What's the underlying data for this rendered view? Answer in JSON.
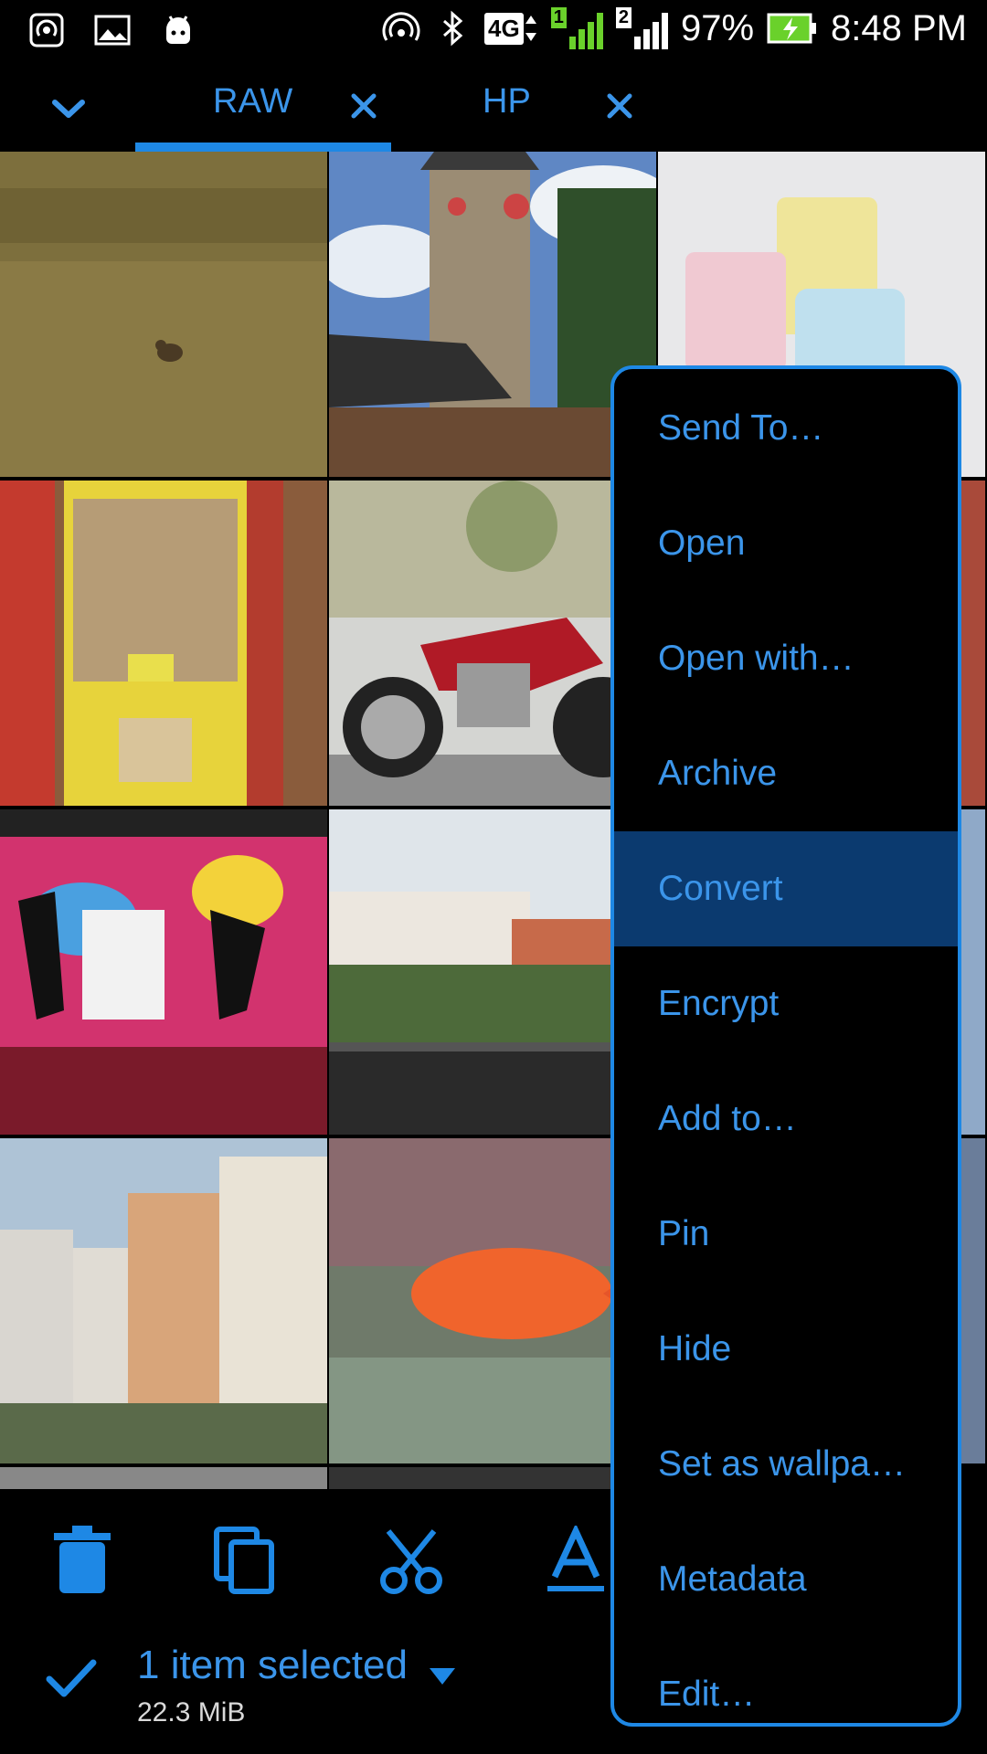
{
  "status_bar": {
    "network": "4G",
    "sim1": "1",
    "sim2": "2",
    "battery": "97%",
    "time": "8:48 PM"
  },
  "tabs": [
    {
      "label": "RAW",
      "active": true
    },
    {
      "label": "HP",
      "active": false
    }
  ],
  "grid": {
    "thumbnails": [
      "bird-in-grass",
      "church-clock-tower",
      "plastic-cups",
      "yellow-dispenser",
      "red-motorcycle",
      "partial-image",
      "graffiti-wall",
      "apartment-balcony",
      "partial-image",
      "high-rise-buildings",
      "orange-fish",
      "partial-image"
    ]
  },
  "actions": {
    "icons": [
      "trash-icon",
      "copy-icon",
      "cut-icon",
      "rename-icon"
    ]
  },
  "selection": {
    "label": "1 item selected",
    "size": "22.3 MiB"
  },
  "menu": {
    "items": [
      "Send To…",
      "Open",
      "Open with…",
      "Archive",
      "Convert",
      "Encrypt",
      "Add to…",
      "Pin",
      "Hide",
      "Set as wallpa…",
      "Metadata",
      "Edit…"
    ],
    "highlighted": "Convert"
  },
  "colors": {
    "accent": "#1e88e5",
    "text_accent": "#3b95ea",
    "highlight": "#0b3a6f",
    "background": "#000000"
  }
}
